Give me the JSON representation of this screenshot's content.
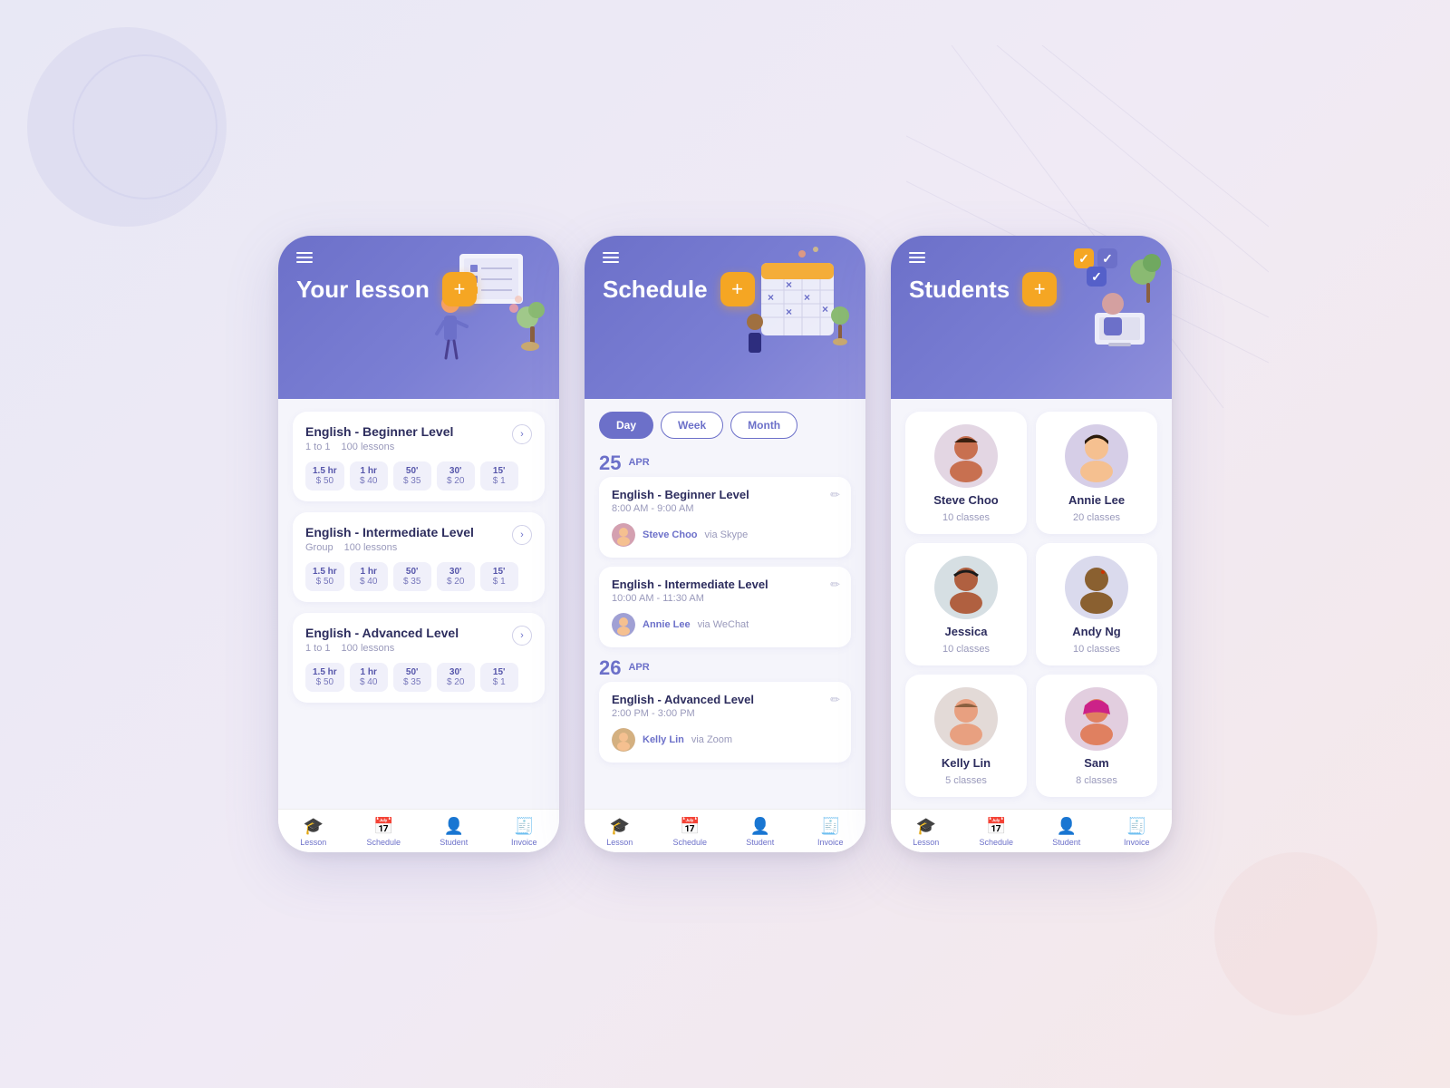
{
  "background": {
    "color1": "#e8e8f5",
    "color2": "#f0eaf5",
    "color3": "#f5e8e8"
  },
  "phone1": {
    "header_title": "Your lesson",
    "add_btn": "+",
    "lessons": [
      {
        "title": "English - Beginner Level",
        "type": "1 to 1",
        "lessons_count": "100 lessons",
        "prices": [
          {
            "duration": "1.5 hr",
            "price": "$ 50"
          },
          {
            "duration": "1 hr",
            "price": "$ 40"
          },
          {
            "duration": "50'",
            "price": "$ 35"
          },
          {
            "duration": "30'",
            "price": "$ 20"
          },
          {
            "duration": "15'",
            "price": "$ 1"
          }
        ]
      },
      {
        "title": "English - Intermediate Level",
        "type": "Group",
        "lessons_count": "100 lessons",
        "prices": [
          {
            "duration": "1.5 hr",
            "price": "$ 50"
          },
          {
            "duration": "1 hr",
            "price": "$ 40"
          },
          {
            "duration": "50'",
            "price": "$ 35"
          },
          {
            "duration": "30'",
            "price": "$ 20"
          },
          {
            "duration": "15'",
            "price": "$ 1"
          }
        ]
      },
      {
        "title": "English - Advanced Level",
        "type": "1 to 1",
        "lessons_count": "100 lessons",
        "prices": [
          {
            "duration": "1.5 hr",
            "price": "$ 50"
          },
          {
            "duration": "1 hr",
            "price": "$ 40"
          },
          {
            "duration": "50'",
            "price": "$ 35"
          },
          {
            "duration": "30'",
            "price": "$ 20"
          },
          {
            "duration": "15'",
            "price": "$ 1"
          }
        ]
      }
    ],
    "nav": [
      "Lesson",
      "Schedule",
      "Student",
      "Invoice"
    ]
  },
  "phone2": {
    "header_title": "Schedule",
    "add_btn": "+",
    "filters": [
      "Day",
      "Week",
      "Month"
    ],
    "active_filter": "Day",
    "schedule_groups": [
      {
        "date_number": "25",
        "date_month": "APR",
        "items": [
          {
            "title": "English - Beginner Level",
            "time": "8:00 AM - 9:00 AM",
            "student_name": "Steve Choo",
            "via": "via Skype"
          },
          {
            "title": "English - Intermediate Level",
            "time": "10:00 AM - 11:30 AM",
            "student_name": "Annie Lee",
            "via": "via WeChat"
          }
        ]
      },
      {
        "date_number": "26",
        "date_month": "APR",
        "items": [
          {
            "title": "English - Advanced Level",
            "time": "2:00 PM - 3:00 PM",
            "student_name": "Kelly Lin",
            "via": "via Zoom"
          }
        ]
      }
    ],
    "nav": [
      "Lesson",
      "Schedule",
      "Student",
      "Invoice"
    ]
  },
  "phone3": {
    "header_title": "Students",
    "add_btn": "+",
    "students": [
      {
        "name": "Steve Choo",
        "classes": "10 classes",
        "color": "#d4a0b0"
      },
      {
        "name": "Annie Lee",
        "classes": "20 classes",
        "color": "#a0a0d4"
      },
      {
        "name": "Jessica",
        "classes": "10 classes",
        "color": "#a0c4b0"
      },
      {
        "name": "Andy Ng",
        "classes": "10 classes",
        "color": "#b0b0d8"
      },
      {
        "name": "Kelly Lin",
        "classes": "5 classes",
        "color": "#d4b080"
      },
      {
        "name": "Sam",
        "classes": "8 classes",
        "color": "#d080a0"
      }
    ],
    "nav": [
      "Lesson",
      "Schedule",
      "Student",
      "Invoice"
    ]
  }
}
